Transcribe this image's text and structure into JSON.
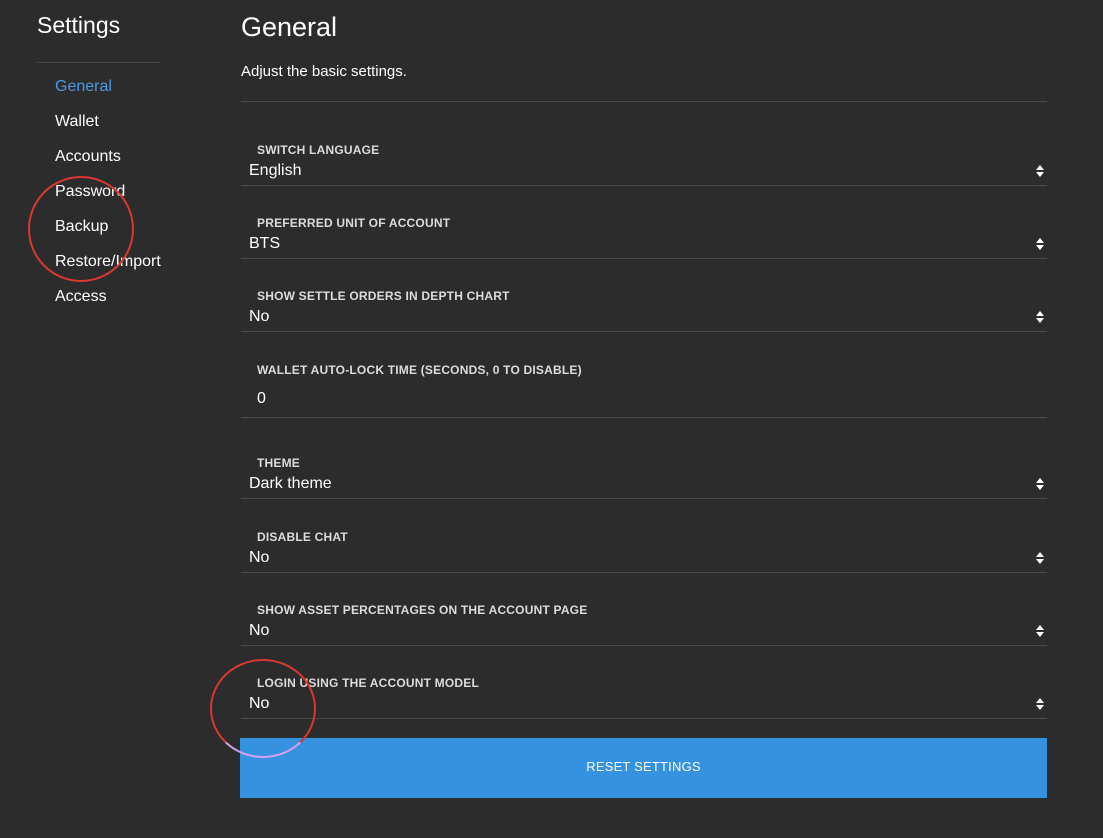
{
  "sidebar": {
    "title": "Settings",
    "items": [
      {
        "label": "General",
        "active": true
      },
      {
        "label": "Wallet",
        "active": false
      },
      {
        "label": "Accounts",
        "active": false
      },
      {
        "label": "Password",
        "active": false
      },
      {
        "label": "Backup",
        "active": false
      },
      {
        "label": "Restore/Import",
        "active": false
      },
      {
        "label": "Access",
        "active": false
      }
    ]
  },
  "main": {
    "title": "General",
    "subtitle": "Adjust the basic settings.",
    "fields": [
      {
        "label": "SWITCH LANGUAGE",
        "value": "English",
        "type": "select"
      },
      {
        "label": "PREFERRED UNIT OF ACCOUNT",
        "value": "BTS",
        "type": "select"
      },
      {
        "label": "SHOW SETTLE ORDERS IN DEPTH CHART",
        "value": "No",
        "type": "select"
      },
      {
        "label": "WALLET AUTO-LOCK TIME (SECONDS, 0 TO DISABLE)",
        "value": "0",
        "type": "input"
      },
      {
        "label": "THEME",
        "value": "Dark theme",
        "type": "select"
      },
      {
        "label": "DISABLE CHAT",
        "value": "No",
        "type": "select"
      },
      {
        "label": "SHOW ASSET PERCENTAGES ON THE ACCOUNT PAGE",
        "value": "No",
        "type": "select"
      },
      {
        "label": "LOGIN USING THE ACCOUNT MODEL",
        "value": "No",
        "type": "select"
      }
    ],
    "reset_label": "RESET SETTINGS"
  },
  "colors": {
    "background": "#2c2c2c",
    "accent": "#4a9ae4",
    "button": "#3592e0",
    "annotation": "#d8382f"
  },
  "icons": {
    "select_arrows": "sort-arrows-icon"
  }
}
